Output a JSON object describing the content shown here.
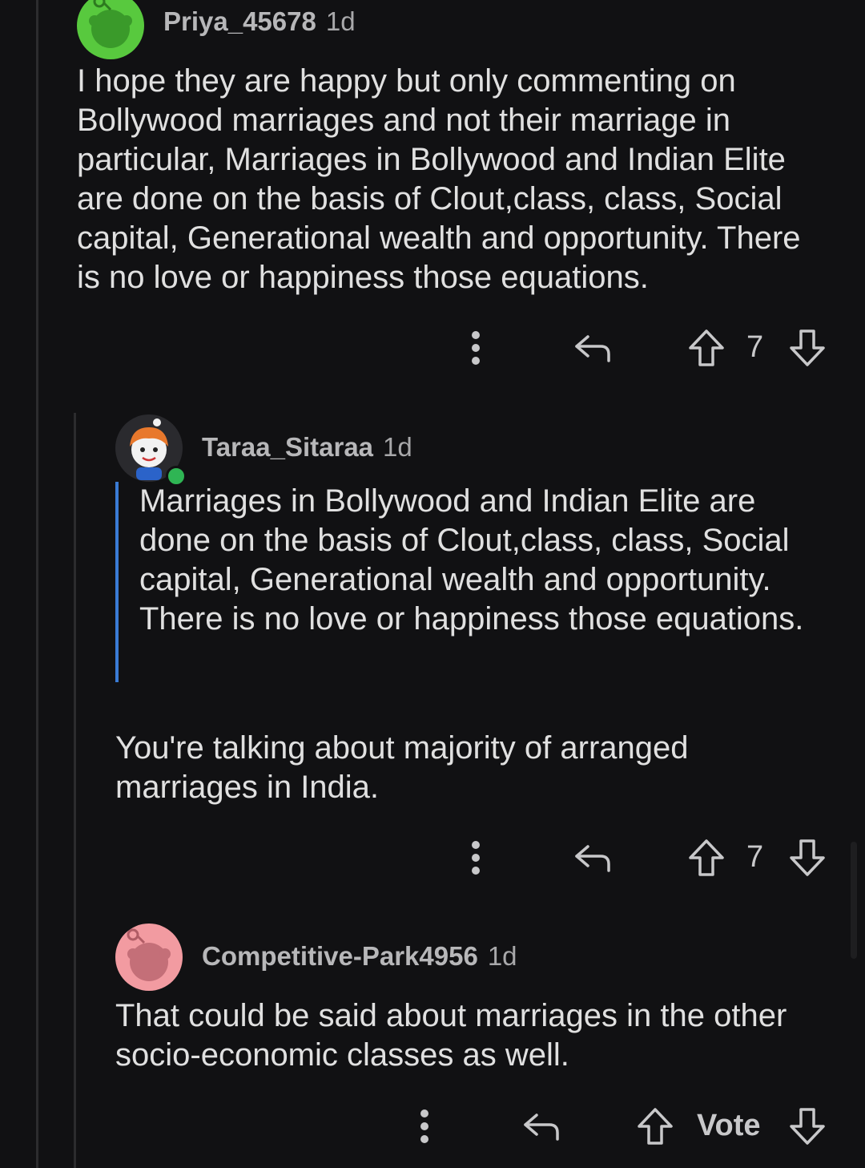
{
  "comments": [
    {
      "username": "Priya_45678",
      "time": "1d",
      "avatar_color": "#58c93e",
      "body": "I hope they are happy but only commenting on Bollywood marriages and not their marriage in particular, Marriages in Bollywood and Indian Elite are done on the basis of Clout,class, class, Social capital, Generational wealth and opportunity. There is no love or happiness those equations.",
      "votes": "7"
    },
    {
      "username": "Taraa_Sitaraa",
      "time": "1d",
      "avatar_color": "#2a2a2e",
      "online": true,
      "quote": "Marriages in Bollywood and Indian Elite are done on the basis of Clout,class, class, Social capital, Generational wealth and opportunity. There is no love or happiness those equations.",
      "body": "You're talking about majority of arranged marriages in India.",
      "votes": "7"
    },
    {
      "username": "Competitive-Park4956",
      "time": "1d",
      "avatar_color": "#f29ba1",
      "body": "That could be said about marriages in the other socio-economic classes as well.",
      "votes": "Vote"
    }
  ],
  "icons": {
    "more": "more-vertical-icon",
    "reply": "reply-icon",
    "upvote": "upvote-icon",
    "downvote": "downvote-icon"
  },
  "colors": {
    "background": "#111113",
    "quote_bar": "#3a7bd5",
    "online": "#2fb554"
  }
}
